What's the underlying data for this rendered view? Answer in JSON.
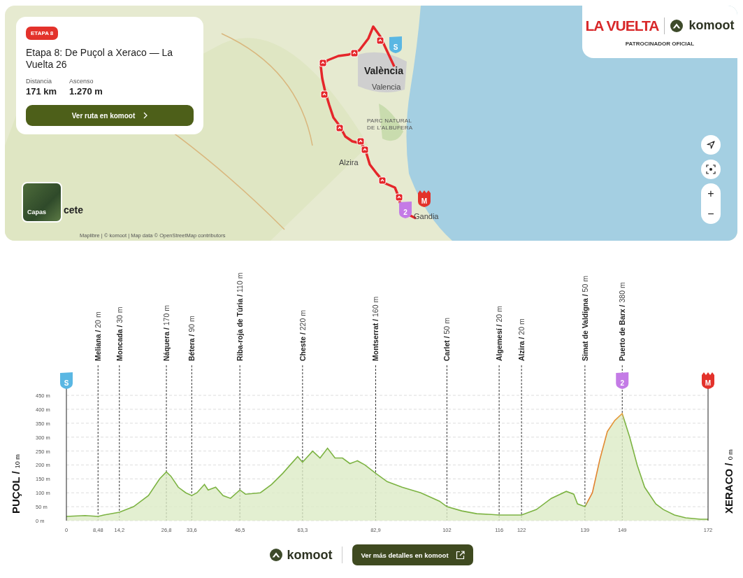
{
  "map": {
    "card": {
      "badge": "ETAPA 8",
      "title": "Etapa 8: De Puçol a Xeraco — La Vuelta 26",
      "stats": [
        {
          "label": "Distancia",
          "value": "171 km"
        },
        {
          "label": "Ascenso",
          "value": "1.270 m"
        }
      ],
      "button": "Ver ruta en komoot"
    },
    "sponsor": {
      "brand": "LA VUELTA",
      "partner": "komoot",
      "caption": "PATROCINADOR OFICIAL"
    },
    "places": [
      {
        "label": "València",
        "kind": "city"
      },
      {
        "label": "Valencia",
        "kind": "town"
      },
      {
        "label": "PARC NATURAL\nDE L'ALBUFERA",
        "kind": "park"
      },
      {
        "label": "Alzira",
        "kind": "town"
      },
      {
        "label": "Gandia",
        "kind": "town"
      },
      {
        "label": "cete",
        "kind": "city"
      }
    ],
    "markers": [
      {
        "kind": "start",
        "label": "S"
      },
      {
        "kind": "climb",
        "label": "2"
      },
      {
        "kind": "finish",
        "label": "M"
      }
    ],
    "zoom_in": "+",
    "zoom_out": "−",
    "layers": "Capas",
    "attribution": "Maplibre | © komoot | Map data © OpenStreetMap contributors"
  },
  "profile": {
    "start_label": "PUÇOL /",
    "start_elevation": "10 m",
    "end_label": "XERACO /",
    "end_elevation": "0 m",
    "start_marker": "S",
    "finish_marker": "M",
    "waypoints": [
      {
        "label": "Meliana /",
        "elevation": "20 m"
      },
      {
        "label": "Moncada /",
        "elevation": "30 m"
      },
      {
        "label": "Náquera /",
        "elevation": "170 m"
      },
      {
        "label": "Bétera /",
        "elevation": "90 m"
      },
      {
        "label": "Riba-roja de Túria /",
        "elevation": "110 m"
      },
      {
        "label": "Cheste /",
        "elevation": "220 m"
      },
      {
        "label": "Montserrat /",
        "elevation": "160 m"
      },
      {
        "label": "Carlet /",
        "elevation": "50 m"
      },
      {
        "label": "Algemesí /",
        "elevation": "20 m"
      },
      {
        "label": "Alzira /",
        "elevation": "20 m"
      },
      {
        "label": "Simat de Valdigna /",
        "elevation": "50 m"
      },
      {
        "label": "Puerto de Barx /",
        "elevation": "380 m",
        "climb_marker": "2"
      }
    ],
    "chart_data": {
      "type": "area",
      "grid": true,
      "xlim": [
        0,
        172
      ],
      "ylim": [
        0,
        450
      ],
      "x": [
        0,
        5,
        8.48,
        10,
        14.2,
        18,
        22,
        25,
        26.8,
        28,
        30,
        32,
        33.6,
        35,
        37,
        38,
        40,
        42,
        44,
        46.5,
        48,
        52,
        55,
        58,
        60,
        62,
        63.3,
        66,
        68,
        70,
        72,
        74,
        76,
        78,
        80,
        82.9,
        86,
        90,
        95,
        100,
        102,
        106,
        110,
        114,
        116,
        120,
        122,
        126,
        130,
        134,
        136,
        137,
        139,
        141,
        143,
        145,
        147,
        149,
        151,
        153,
        155,
        158,
        160,
        163,
        166,
        170,
        172
      ],
      "series": [
        {
          "color": "#7cb342",
          "values": [
            15,
            18,
            15,
            20,
            30,
            50,
            90,
            150,
            175,
            160,
            120,
            100,
            90,
            100,
            130,
            110,
            120,
            90,
            80,
            110,
            95,
            100,
            130,
            170,
            200,
            230,
            210,
            250,
            225,
            260,
            225,
            225,
            205,
            215,
            200,
            170,
            140,
            120,
            100,
            70,
            50,
            35,
            25,
            22,
            20,
            20,
            20,
            40,
            80,
            105,
            95,
            60,
            50,
            100,
            220,
            320,
            360,
            385,
            300,
            200,
            120,
            60,
            40,
            20,
            10,
            5,
            5
          ]
        }
      ],
      "xticks": [
        0,
        {
          "value": 8.48,
          "label": "8,48"
        },
        {
          "value": 14.2,
          "label": "14,2"
        },
        {
          "value": 26.8,
          "label": "26,8"
        },
        {
          "value": 33.6,
          "label": "33,6"
        },
        {
          "value": 46.5,
          "label": "46,5"
        },
        {
          "value": 63.3,
          "label": "63,3"
        },
        {
          "value": 82.9,
          "label": "82,9"
        },
        102,
        116,
        122,
        139,
        149,
        172
      ],
      "yticks": [
        {
          "value": 0,
          "label": "0 m"
        },
        {
          "value": 50,
          "label": "50 m"
        },
        {
          "value": 100,
          "label": "100 m"
        },
        {
          "value": 150,
          "label": "150 m"
        },
        {
          "value": 200,
          "label": "200 m"
        },
        {
          "value": 250,
          "label": "250 m"
        },
        {
          "value": 300,
          "label": "300 m"
        },
        {
          "value": 350,
          "label": "350 m"
        },
        {
          "value": 400,
          "label": "400 m"
        },
        {
          "value": 450,
          "label": "450 m"
        }
      ]
    }
  },
  "footer": {
    "brand": "komoot",
    "button": "Ver más detalles en komoot"
  }
}
